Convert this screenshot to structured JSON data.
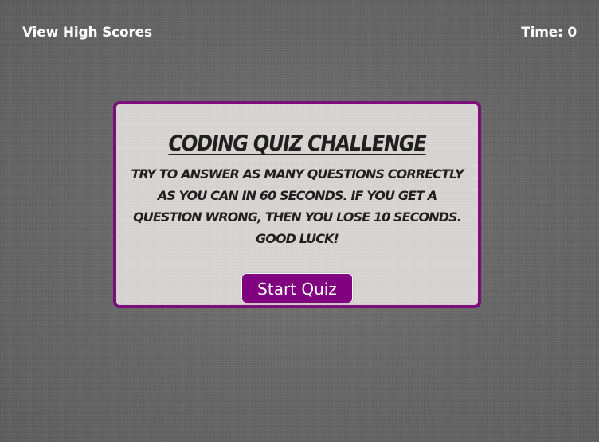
{
  "header": {
    "high_scores_label": "View High Scores",
    "timer_label": "Time: 0"
  },
  "card": {
    "title": "Coding Quiz Challenge",
    "instructions": "Try to answer as many questions correctly as you can in 60 seconds. If you get a question wrong, then you lose 10 seconds. Good luck!",
    "start_button_label": "Start Quiz"
  },
  "colors": {
    "accent": "#800080",
    "card_border": "#7a0f7a",
    "card_background": "#d9d4d4",
    "page_background": "#6b6b6b"
  }
}
